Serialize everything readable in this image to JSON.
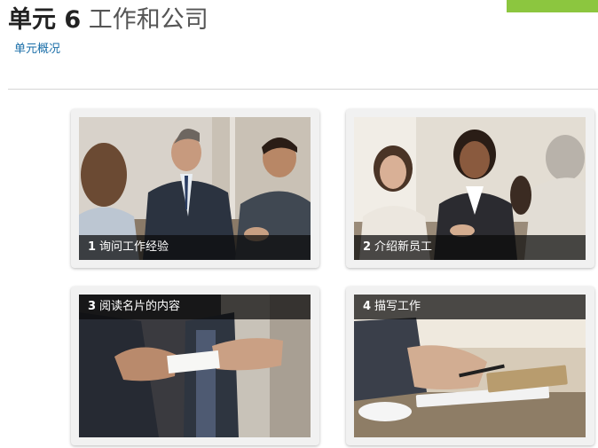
{
  "header": {
    "unit_label": "单元 6",
    "unit_title": "工作和公司",
    "overview_link": "单元概况"
  },
  "theme": {
    "accent": "#8cc63f",
    "link": "#1a6ea8"
  },
  "lessons": [
    {
      "number": "1",
      "title": "询问工作经验"
    },
    {
      "number": "2",
      "title": "介绍新员工"
    },
    {
      "number": "3",
      "title": "阅读名片的内容"
    },
    {
      "number": "4",
      "title": "描写工作"
    }
  ]
}
